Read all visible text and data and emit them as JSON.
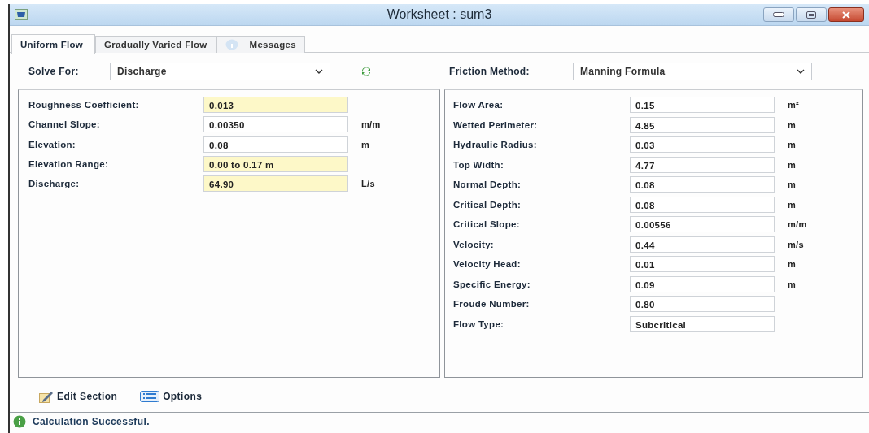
{
  "window": {
    "title": "Worksheet : sum3"
  },
  "tabs": [
    {
      "label": "Uniform Flow",
      "selected": true,
      "kind": "text"
    },
    {
      "label": "Gradually Varied Flow",
      "selected": false,
      "kind": "text"
    },
    {
      "label": "Messages",
      "selected": false,
      "kind": "info"
    }
  ],
  "solve_for": {
    "label": "Solve For:",
    "value": "Discharge"
  },
  "friction_method": {
    "label": "Friction Method:",
    "value": "Manning Formula"
  },
  "inputs": [
    {
      "label": "Roughness Coefficient:",
      "value": "0.013",
      "highlighted": true
    },
    {
      "label": "Channel Slope:",
      "value": "0.00350",
      "unit": "m/m",
      "highlighted": false
    },
    {
      "label": "Elevation:",
      "value": "0.08",
      "unit": "m",
      "highlighted": false
    },
    {
      "label": "Elevation Range:",
      "value": "0.00 to 0.17 m",
      "highlighted": true
    },
    {
      "label": "Discharge:",
      "value": "64.90",
      "unit": "L/s",
      "highlighted": true
    }
  ],
  "results": [
    {
      "label": "Flow Area:",
      "value": "0.15",
      "unit": "m²",
      "highlighted": false
    },
    {
      "label": "Wetted Perimeter:",
      "value": "4.85",
      "unit": "m",
      "highlighted": false
    },
    {
      "label": "Hydraulic Radius:",
      "value": "0.03",
      "unit": "m",
      "highlighted": false
    },
    {
      "label": "Top Width:",
      "value": "4.77",
      "unit": "m",
      "highlighted": false
    },
    {
      "label": "Normal Depth:",
      "value": "0.08",
      "unit": "m",
      "highlighted": false
    },
    {
      "label": "Critical Depth:",
      "value": "0.08",
      "unit": "m",
      "highlighted": false
    },
    {
      "label": "Critical Slope:",
      "value": "0.00556",
      "unit": "m/m",
      "highlighted": false
    },
    {
      "label": "Velocity:",
      "value": "0.44",
      "unit": "m/s",
      "highlighted": false
    },
    {
      "label": "Velocity Head:",
      "value": "0.01",
      "unit": "m",
      "highlighted": false
    },
    {
      "label": "Specific Energy:",
      "value": "0.09",
      "unit": "m",
      "highlighted": false
    },
    {
      "label": "Froude Number:",
      "value": "0.80",
      "highlighted": false
    },
    {
      "label": "Flow Type:",
      "value": "Subcritical",
      "highlighted": false
    }
  ],
  "actions": [
    {
      "label": "Edit Section",
      "kind": "edit"
    },
    {
      "label": "Options",
      "kind": "options"
    }
  ],
  "status_bar": {
    "message": "Calculation Successful."
  }
}
